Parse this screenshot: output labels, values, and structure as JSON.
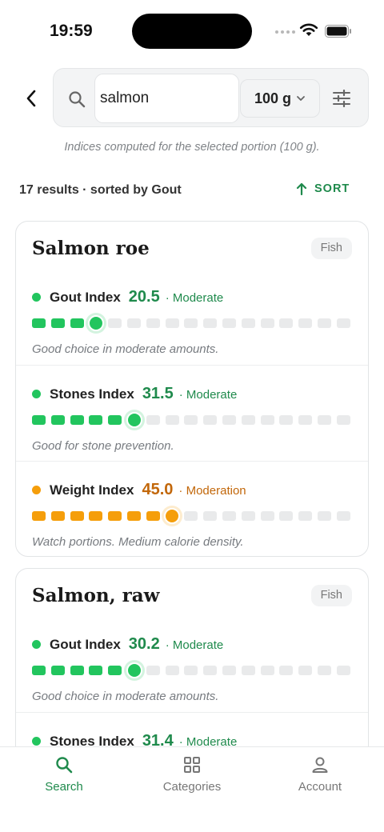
{
  "status_bar": {
    "time": "19:59"
  },
  "search": {
    "query": "salmon",
    "portion": "100 g",
    "portion_note": "Indices computed for the selected portion (100 g)."
  },
  "results": {
    "summary": "17 results · sorted by Gout",
    "sort_label": "SORT"
  },
  "colors": {
    "accent": "#1f8a4c",
    "good": "#22c55e",
    "good_text": "#1f8a4c",
    "moderation": "#f59e0b",
    "moderation_text": "#c2670a",
    "track_empty": "#e9eaeb"
  },
  "cards": [
    {
      "title": "Salmon roe",
      "tag": "Fish",
      "indices": [
        {
          "name": "Gout Index",
          "value": "20.5",
          "level": "· Moderate",
          "note": "Good choice in moderate amounts.",
          "status": "good",
          "filled_segments": 4
        },
        {
          "name": "Stones Index",
          "value": "31.5",
          "level": "· Moderate",
          "note": "Good for stone prevention.",
          "status": "good",
          "filled_segments": 6
        },
        {
          "name": "Weight Index",
          "value": "45.0",
          "level": "· Moderation",
          "note": "Watch portions. Medium calorie density.",
          "status": "moderation",
          "filled_segments": 8
        }
      ]
    },
    {
      "title": "Salmon, raw",
      "tag": "Fish",
      "indices": [
        {
          "name": "Gout Index",
          "value": "30.2",
          "level": "· Moderate",
          "note": "Good choice in moderate amounts.",
          "status": "good",
          "filled_segments": 6
        },
        {
          "name": "Stones Index",
          "value": "31.4",
          "level": "· Moderate",
          "note": "",
          "status": "good",
          "filled_segments": 6
        }
      ]
    }
  ],
  "nav": {
    "items": [
      {
        "label": "Search",
        "icon": "search-icon",
        "active": true
      },
      {
        "label": "Categories",
        "icon": "grid-icon",
        "active": false
      },
      {
        "label": "Account",
        "icon": "person-icon",
        "active": false
      }
    ]
  }
}
